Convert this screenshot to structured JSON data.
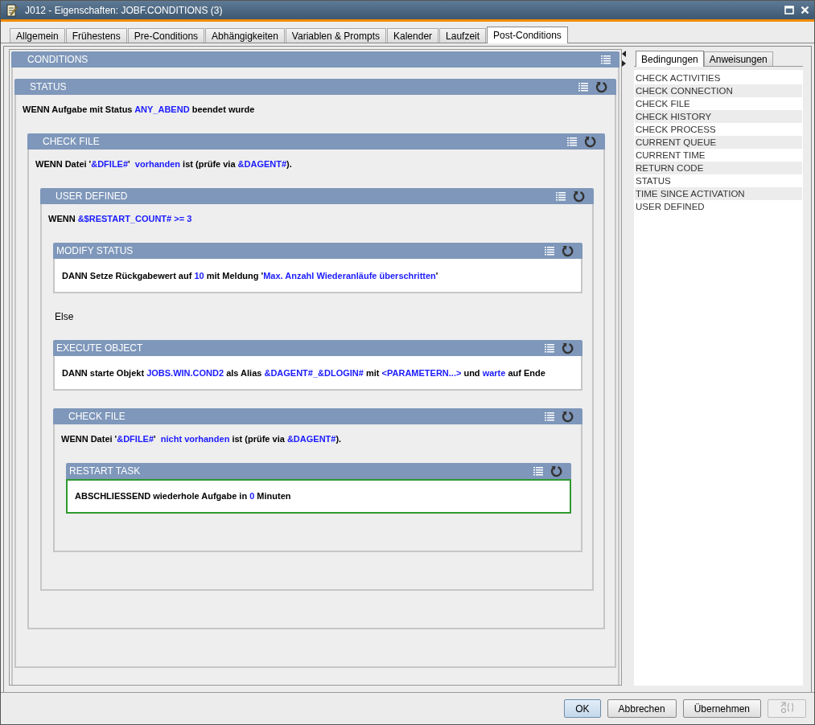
{
  "window": {
    "title": "J012 - Eigenschaften: JOBF.CONDITIONS (3)"
  },
  "tabs": [
    {
      "label": "Allgemein",
      "selected": false
    },
    {
      "label": "Frühestens",
      "selected": false
    },
    {
      "label": "Pre-Conditions",
      "selected": false
    },
    {
      "label": "Abhängigkeiten",
      "selected": false
    },
    {
      "label": "Variablen & Prompts",
      "selected": false
    },
    {
      "label": "Kalender",
      "selected": false
    },
    {
      "label": "Laufzeit",
      "selected": false
    },
    {
      "label": "Post-Conditions",
      "selected": true
    }
  ],
  "editor": {
    "kind": "root",
    "title": "CONDITIONS",
    "children": [
      {
        "kind": "condition",
        "title": "STATUS",
        "selected": false,
        "text": [
          {
            "text": "WENN Aufgabe mit Status ",
            "highlight": false
          },
          {
            "text": "ANY_ABEND",
            "highlight": true
          },
          {
            "text": " beendet wurde",
            "highlight": false
          }
        ],
        "children": [
          {
            "kind": "condition",
            "title": "CHECK FILE",
            "selected": false,
            "text": [
              {
                "text": "WENN Datei '",
                "highlight": false
              },
              {
                "text": "&DFILE#",
                "highlight": true
              },
              {
                "text": "'  ",
                "highlight": false
              },
              {
                "text": "vorhanden",
                "highlight": true
              },
              {
                "text": " ist (prüfe via ",
                "highlight": false
              },
              {
                "text": "&DAGENT#",
                "highlight": true
              },
              {
                "text": ").",
                "highlight": false
              }
            ],
            "children": [
              {
                "kind": "condition",
                "title": "USER DEFINED",
                "selected": false,
                "text": [
                  {
                    "text": "WENN ",
                    "highlight": false
                  },
                  {
                    "text": "&$RESTART_COUNT# >= 3",
                    "highlight": true
                  }
                ],
                "children": [
                  {
                    "kind": "action",
                    "title": "MODIFY STATUS",
                    "selected": false,
                    "text": [
                      {
                        "text": "DANN Setze Rückgabewert auf ",
                        "highlight": false
                      },
                      {
                        "text": "10",
                        "highlight": true
                      },
                      {
                        "text": " mit Meldung '",
                        "highlight": false
                      },
                      {
                        "text": "Max. Anzahl Wiederanläufe überschritten",
                        "highlight": true
                      },
                      {
                        "text": "'",
                        "highlight": false
                      }
                    ]
                  },
                  {
                    "kind": "label",
                    "title": "Else"
                  },
                  {
                    "kind": "action",
                    "title": "EXECUTE OBJECT",
                    "selected": false,
                    "text": [
                      {
                        "text": "DANN starte Objekt ",
                        "highlight": false
                      },
                      {
                        "text": "JOBS.WIN.COND2",
                        "highlight": true
                      },
                      {
                        "text": " als Alias ",
                        "highlight": false
                      },
                      {
                        "text": "&DAGENT#_&DLOGIN#",
                        "highlight": true
                      },
                      {
                        "text": " mit ",
                        "highlight": false
                      },
                      {
                        "text": "<PARAMETERN...>",
                        "highlight": true
                      },
                      {
                        "text": " und ",
                        "highlight": false
                      },
                      {
                        "text": "warte",
                        "highlight": true
                      },
                      {
                        "text": " auf Ende",
                        "highlight": false
                      }
                    ]
                  },
                  {
                    "kind": "condition",
                    "title": "CHECK FILE",
                    "selected": false,
                    "text": [
                      {
                        "text": "WENN Datei '",
                        "highlight": false
                      },
                      {
                        "text": "&DFILE#",
                        "highlight": true
                      },
                      {
                        "text": "'  ",
                        "highlight": false
                      },
                      {
                        "text": "nicht vorhanden",
                        "highlight": true
                      },
                      {
                        "text": " ist (prüfe via ",
                        "highlight": false
                      },
                      {
                        "text": "&DAGENT#",
                        "highlight": true
                      },
                      {
                        "text": ").",
                        "highlight": false
                      }
                    ],
                    "children": [
                      {
                        "kind": "action",
                        "title": "RESTART TASK",
                        "selected": true,
                        "text": [
                          {
                            "text": "ABSCHLIESSEND wiederhole Aufgabe in ",
                            "highlight": false
                          },
                          {
                            "text": "0",
                            "highlight": true
                          },
                          {
                            "text": " Minuten",
                            "highlight": false
                          }
                        ]
                      }
                    ]
                  }
                ]
              }
            ]
          }
        ]
      }
    ]
  },
  "palette": {
    "tabs": [
      {
        "label": "Bedingungen",
        "selected": true
      },
      {
        "label": "Anweisungen",
        "selected": false
      }
    ],
    "items": [
      "CHECK ACTIVITIES",
      "CHECK CONNECTION",
      "CHECK FILE",
      "CHECK HISTORY",
      "CHECK PROCESS",
      "CURRENT QUEUE",
      "CURRENT TIME",
      "RETURN CODE",
      "STATUS",
      "TIME SINCE ACTIVATION",
      "USER DEFINED"
    ]
  },
  "buttons": [
    {
      "kind": "text",
      "label": "OK",
      "focused": true,
      "disabled": false
    },
    {
      "kind": "text",
      "label": "Abbrechen",
      "focused": false,
      "disabled": false
    },
    {
      "kind": "text",
      "label": "Übernehmen",
      "focused": false,
      "disabled": false
    },
    {
      "kind": "icon",
      "focused": false,
      "disabled": true
    }
  ]
}
